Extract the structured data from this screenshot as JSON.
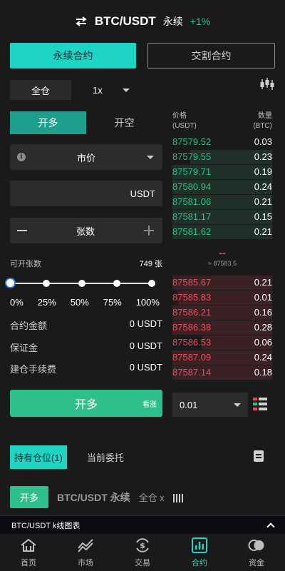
{
  "header": {
    "pair": "BTC/USDT",
    "type": "永续",
    "change": "+1%",
    "change_color": "#2fbf8a"
  },
  "contract_tabs": [
    {
      "label": "永续合约",
      "active": true
    },
    {
      "label": "交割合约",
      "active": false
    }
  ],
  "margin": {
    "mode": "全仓",
    "leverage": "1x"
  },
  "side_tabs": [
    {
      "label": "开多",
      "active": true
    },
    {
      "label": "开空",
      "active": false
    }
  ],
  "order_form": {
    "order_type": "市价",
    "price_unit": "USDT",
    "quantity_placeholder": "张数",
    "available_label": "可开张数",
    "available_value": "749 张",
    "slider_value_percent": 0,
    "slider_marks": [
      "0%",
      "25%",
      "50%",
      "75%",
      "100%"
    ],
    "summary": [
      {
        "label": "合约金额",
        "value": "0 USDT"
      },
      {
        "label": "保证金",
        "value": "0 USDT"
      },
      {
        "label": "建仓手续费",
        "value": "0 USDT"
      }
    ],
    "submit_label": "开多",
    "submit_sub": "看涨"
  },
  "orderbook": {
    "header": {
      "price": "价格",
      "price_unit": "(USDT)",
      "qty": "数量",
      "qty_unit": "(BTC)"
    },
    "bids": [
      {
        "price": "87579.52",
        "qty": "0.03",
        "depth": 0.0
      },
      {
        "price": "87579.55",
        "qty": "0.23",
        "depth": 0.82
      },
      {
        "price": "87579.71",
        "qty": "0.19",
        "depth": 1.0
      },
      {
        "price": "87580.94",
        "qty": "0.24",
        "depth": 1.0
      },
      {
        "price": "87581.06",
        "qty": "0.21",
        "depth": 1.0
      },
      {
        "price": "87581.17",
        "qty": "0.15",
        "depth": 1.0
      },
      {
        "price": "87581.62",
        "qty": "0.21",
        "depth": 1.0
      }
    ],
    "mid_price": "--",
    "index_price": "≈ 87583.5",
    "asks": [
      {
        "price": "87585.67",
        "qty": "0.21",
        "depth": 1.0
      },
      {
        "price": "87585.83",
        "qty": "0.01",
        "depth": 0.95
      },
      {
        "price": "87586.21",
        "qty": "0.16",
        "depth": 1.0
      },
      {
        "price": "87586.38",
        "qty": "0.28",
        "depth": 1.0
      },
      {
        "price": "87586.53",
        "qty": "0.06",
        "depth": 0.71
      },
      {
        "price": "87587.09",
        "qty": "0.24",
        "depth": 1.0
      },
      {
        "price": "87587.14",
        "qty": "0.18",
        "depth": 1.0
      }
    ],
    "depth_precision": "0.01"
  },
  "positions": {
    "tabs": [
      {
        "label": "持有仓位(1)",
        "active": true
      },
      {
        "label": "当前委托",
        "active": false
      }
    ],
    "item": {
      "side": "开多",
      "title": "BTC/USDT 永续",
      "meta": "全仓 x"
    }
  },
  "kline_bar": {
    "label": "BTC/USDT k线图表"
  },
  "nav": [
    {
      "label": "首页",
      "icon": "home-icon",
      "active": false
    },
    {
      "label": "市场",
      "icon": "market-trend-icon",
      "active": false
    },
    {
      "label": "交易",
      "icon": "exchange-icon",
      "active": false
    },
    {
      "label": "合约",
      "icon": "contract-chart-icon",
      "active": true
    },
    {
      "label": "资金",
      "icon": "funds-icon",
      "active": false
    }
  ]
}
